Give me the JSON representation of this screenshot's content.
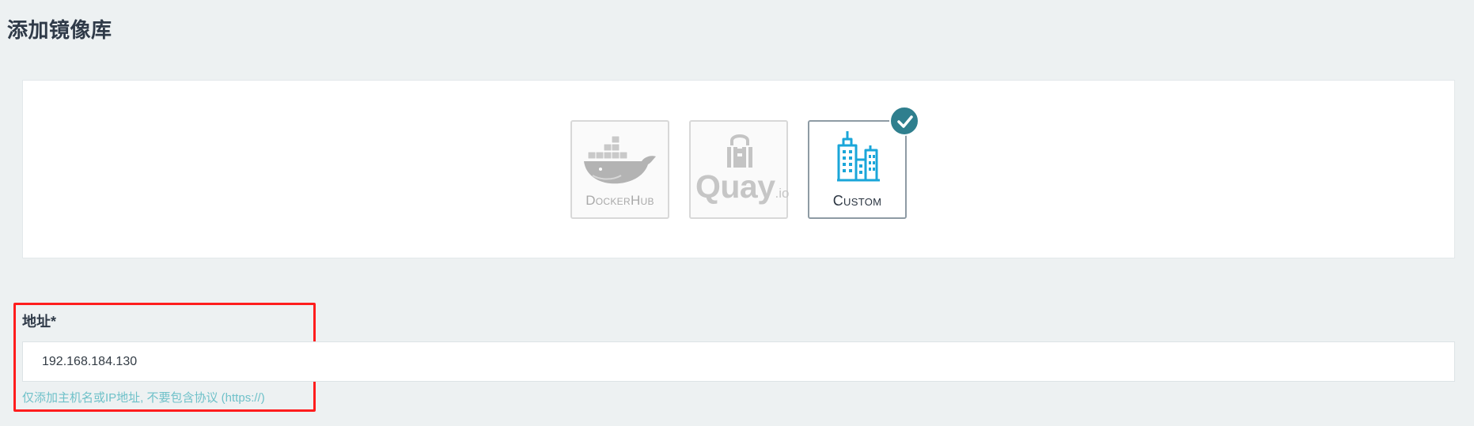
{
  "page": {
    "title": "添加镜像库"
  },
  "registry_types": {
    "items": [
      {
        "id": "dockerhub",
        "label": "DockerHub",
        "selected": false,
        "icon": "docker-whale-icon"
      },
      {
        "id": "quay",
        "label": "Quay",
        "label_suffix": ".io",
        "selected": false,
        "icon": "quay-lock-icon"
      },
      {
        "id": "custom",
        "label": "Custom",
        "selected": true,
        "icon": "buildings-icon"
      }
    ],
    "selected_badge_icon": "checkmark-icon"
  },
  "address_field": {
    "label": "地址",
    "required_mark": "*",
    "value": "192.168.184.130",
    "help": "仅添加主机名或IP地址, 不要包含协议 (https://)"
  },
  "colors": {
    "background": "#edf1f2",
    "accent_teal": "#2f7f8e",
    "custom_icon_blue": "#1aa6d9",
    "help_text": "#6fc1c9",
    "highlight_red": "#ff1d1d"
  }
}
